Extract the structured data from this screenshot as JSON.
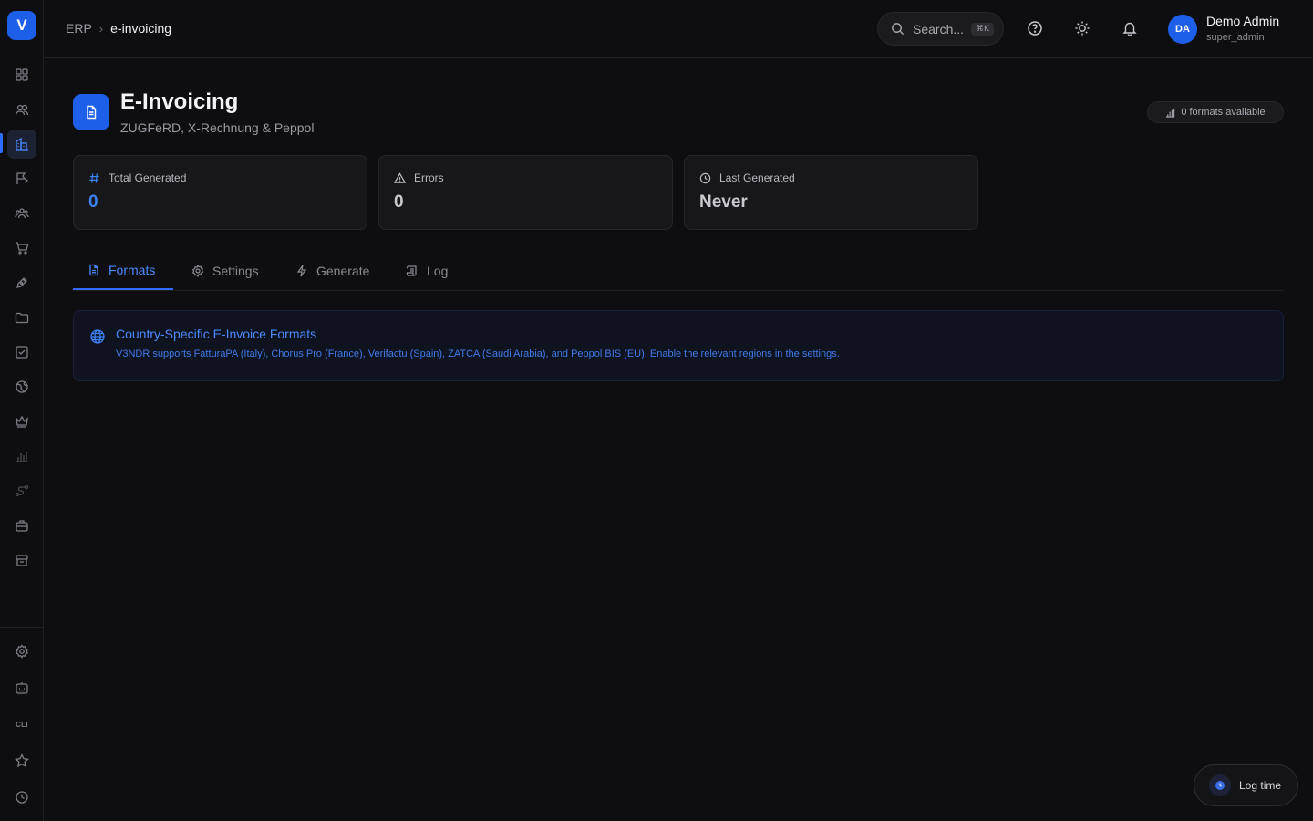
{
  "sidebar": {
    "logo": "V",
    "items": [
      {
        "icon": "dashboard-grid-icon"
      },
      {
        "icon": "users-icon"
      },
      {
        "icon": "building-icon"
      },
      {
        "icon": "flag-icon"
      },
      {
        "icon": "team-icon"
      },
      {
        "icon": "cart-icon"
      },
      {
        "icon": "pen-icon"
      },
      {
        "icon": "folder-icon"
      },
      {
        "icon": "checkbox-icon"
      },
      {
        "icon": "globe-icon"
      },
      {
        "icon": "crown-icon"
      },
      {
        "icon": "bar-chart-icon"
      },
      {
        "icon": "route-icon"
      },
      {
        "icon": "briefcase-icon"
      },
      {
        "icon": "archive-icon"
      }
    ],
    "bottom": [
      {
        "icon": "settings-icon"
      },
      {
        "icon": "robot-icon"
      },
      {
        "label": "CLI"
      },
      {
        "icon": "star-icon"
      },
      {
        "icon": "clock-icon"
      }
    ]
  },
  "header": {
    "breadcrumb_root": "ERP",
    "breadcrumb_sep": "›",
    "breadcrumb_current": "e-invoicing",
    "search_placeholder": "Search...",
    "search_shortcut": "⌘K",
    "user_initials": "DA",
    "user_name": "Demo Admin",
    "user_role": "super_admin"
  },
  "page": {
    "title": "E-Invoicing",
    "subtitle": "ZUGFeRD, X-Rechnung & Peppol",
    "formats_badge": "0 formats available"
  },
  "stats": [
    {
      "label": "Total Generated",
      "value": "0",
      "icon": "hash-icon",
      "color": "#3b82f6"
    },
    {
      "label": "Errors",
      "value": "0",
      "icon": "warning-icon"
    },
    {
      "label": "Last Generated",
      "value": "Never",
      "icon": "clock-icon"
    }
  ],
  "tabs": [
    {
      "label": "Formats",
      "icon": "document-icon",
      "active": true
    },
    {
      "label": "Settings",
      "icon": "gear-icon"
    },
    {
      "label": "Generate",
      "icon": "bolt-icon"
    },
    {
      "label": "Log",
      "icon": "scroll-icon"
    }
  ],
  "info": {
    "title": "Country-Specific E-Invoice Formats",
    "text": "V3NDR supports FatturaPA (Italy), Chorus Pro (France), Verifactu (Spain), ZATCA (Saudi Arabia), and Peppol BIS (EU). Enable the relevant regions in the settings."
  },
  "log_time": {
    "label": "Log time"
  },
  "colors": {
    "accent": "#1d5fe8",
    "link": "#4a8aff",
    "background": "#0e0e10"
  }
}
